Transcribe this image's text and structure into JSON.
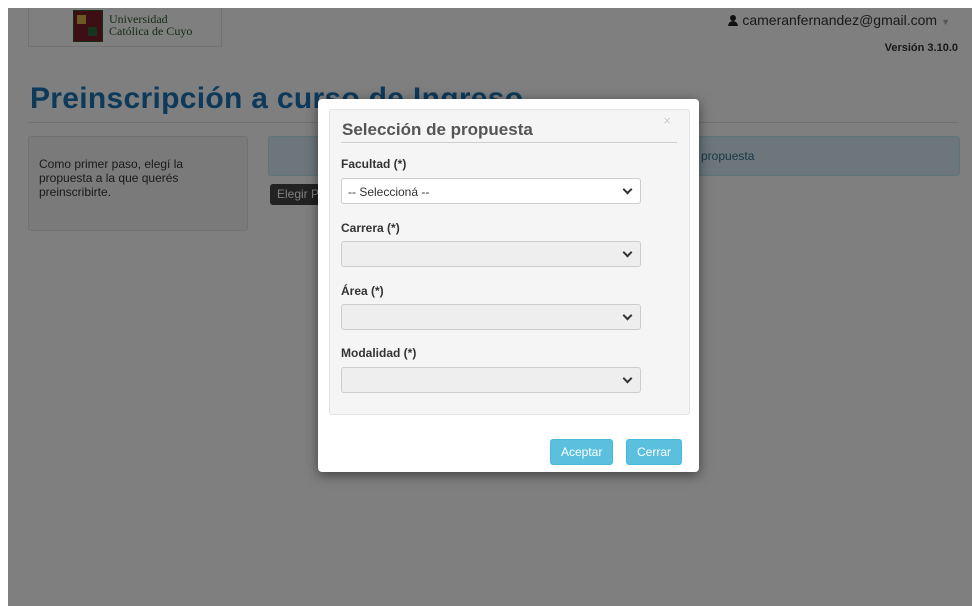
{
  "header": {
    "logo_line1": "Universidad",
    "logo_line2": "Católica de Cuyo",
    "user_email": "cameranfernandez@gmail.com",
    "version": "Versión 3.10.0"
  },
  "page": {
    "title": "Preinscripción a curso de Ingreso",
    "sidebar_text": "Como primer paso, elegí la propuesta a la que querés preinscribirte.",
    "info_text": "propuesta",
    "elegir_button": "Elegir Propuesta"
  },
  "modal": {
    "title": "Selección de propuesta",
    "close_symbol": "×",
    "fields": [
      {
        "label": "Facultad (*)",
        "value": "-- Seleccioná --",
        "disabled": false
      },
      {
        "label": "Carrera (*)",
        "value": "",
        "disabled": true
      },
      {
        "label": "Área (*)",
        "value": "",
        "disabled": true
      },
      {
        "label": "Modalidad (*)",
        "value": "",
        "disabled": true
      }
    ],
    "accept_label": "Aceptar",
    "close_label": "Cerrar"
  },
  "colors": {
    "title": "#1a75b5",
    "button": "#5bc0de",
    "info_bg": "#d9edf7",
    "overlay": "rgba(0,0,0,0.5)"
  }
}
